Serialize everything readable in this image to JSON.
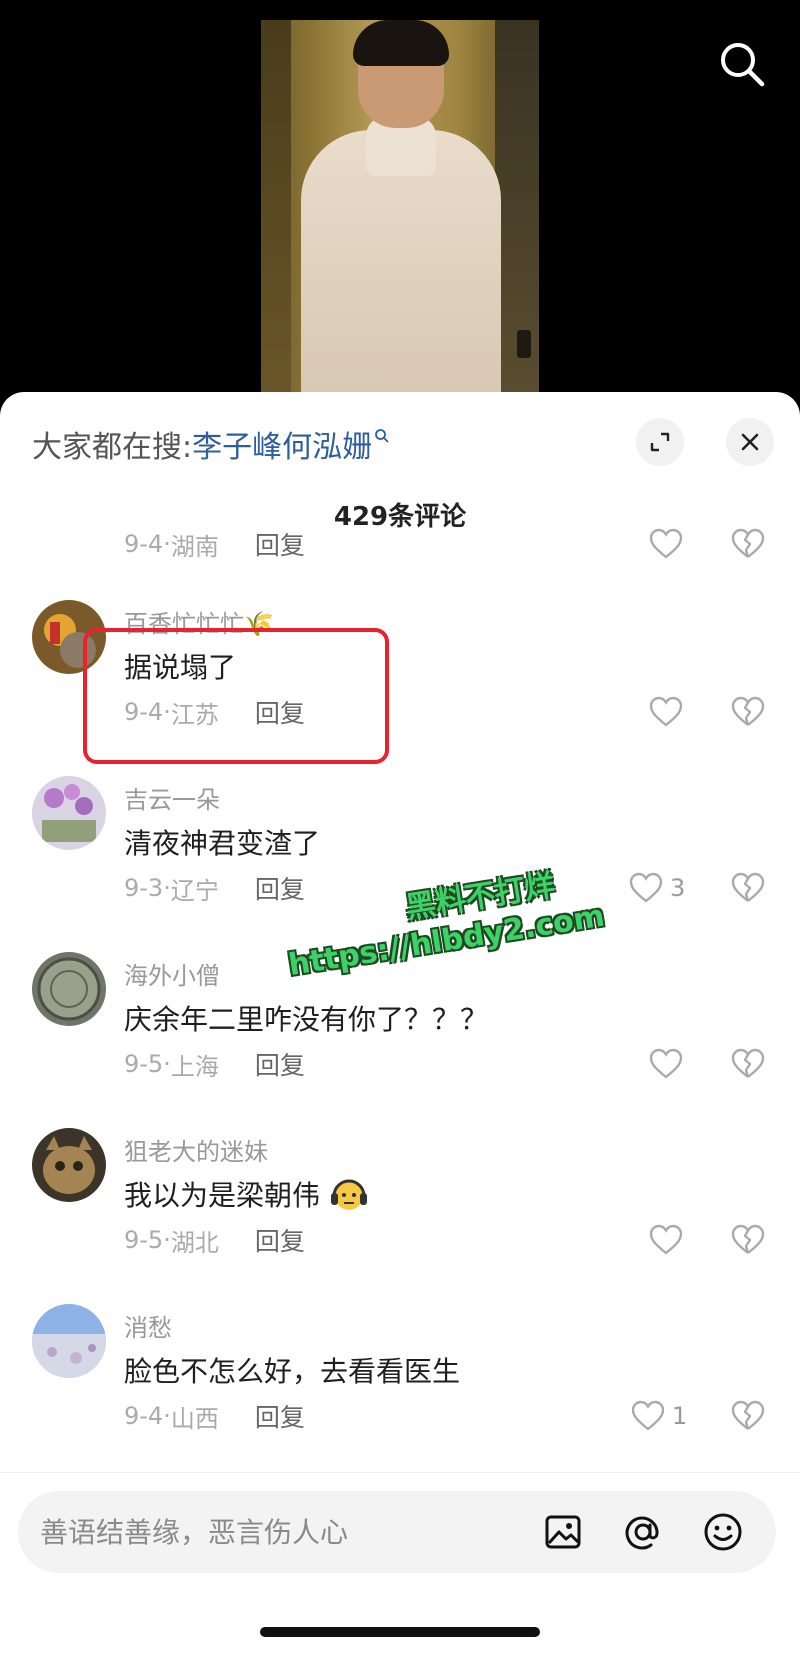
{
  "hot_search": {
    "prefix": "大家都在搜:",
    "keyword": "李子峰何泓姗",
    "keyword_icon": "search-small-icon"
  },
  "header": {
    "comment_count": "429条评论"
  },
  "first_row": {
    "date": "9-4",
    "region": "湖南",
    "reply": "回复",
    "likes": ""
  },
  "comments": [
    {
      "name": "百香忙忙忙",
      "name_emoji": "🌾",
      "text": "据说塌了",
      "date": "9-4",
      "region": "江苏",
      "reply": "回复",
      "likes": ""
    },
    {
      "name": "吉云一朵",
      "text": "清夜神君变渣了",
      "date": "9-3",
      "region": "辽宁",
      "reply": "回复",
      "likes": "3"
    },
    {
      "name": "海外小僧",
      "text": "庆余年二里咋没有你了？？？",
      "date": "9-5",
      "region": "上海",
      "reply": "回复",
      "likes": ""
    },
    {
      "name": "狙老大的迷妹",
      "text": "我以为是梁朝伟",
      "text_emoji": "😶‍🌫",
      "date": "9-5",
      "region": "湖北",
      "reply": "回复",
      "likes": ""
    },
    {
      "name": "消愁",
      "text": "脸色不怎么好，去看看医生",
      "date": "9-4",
      "region": "山西",
      "reply": "回复",
      "likes": "1"
    }
  ],
  "watermark": {
    "line1": "黑料不打烊",
    "line2": "https://hlbdy2.com"
  },
  "input": {
    "placeholder": "善语结善缘，恶言伤人心"
  },
  "colors": {
    "link": "#2f5d9e",
    "highlight": "#e8232d",
    "watermark": "#3fd06a"
  }
}
